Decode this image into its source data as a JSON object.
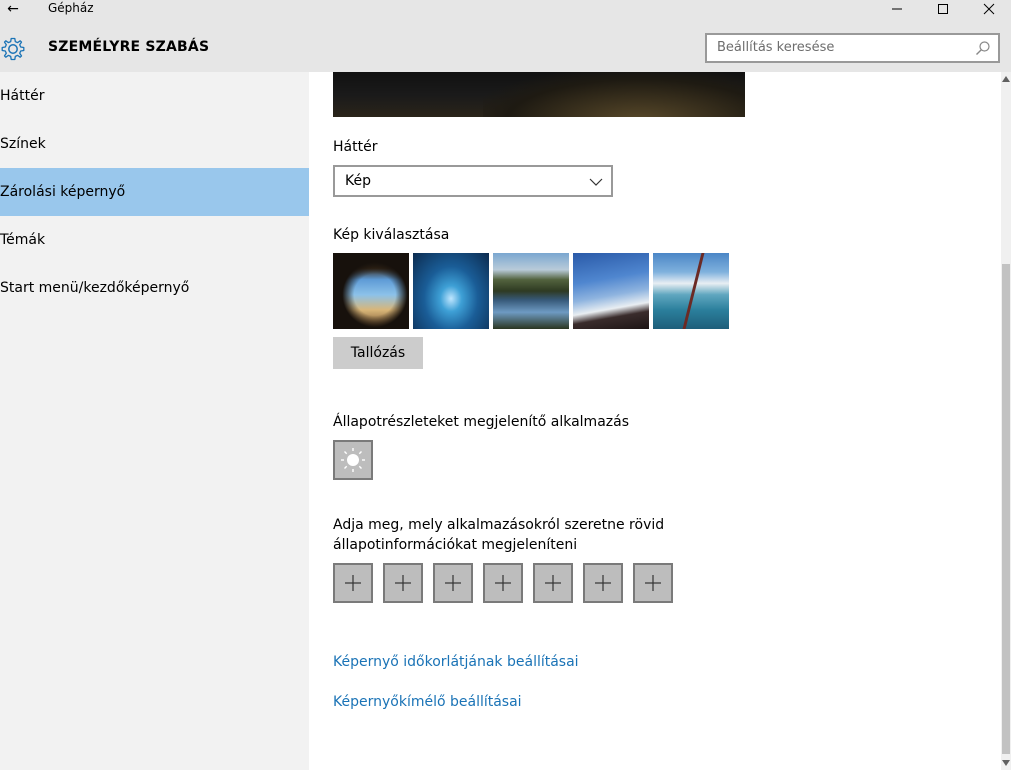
{
  "window": {
    "title": "Gépház",
    "back_glyph": "←"
  },
  "header": {
    "title": "SZEMÉLYRE SZABÁS",
    "search_placeholder": "Beállítás keresése"
  },
  "sidebar": {
    "items": [
      {
        "label": "Háttér",
        "selected": false
      },
      {
        "label": "Színek",
        "selected": false
      },
      {
        "label": "Zárolási képernyő",
        "selected": true
      },
      {
        "label": "Témák",
        "selected": false
      },
      {
        "label": "Start menü/kezdőképernyő",
        "selected": false
      }
    ]
  },
  "content": {
    "background_label": "Háttér",
    "background_select_value": "Kép",
    "choose_picture_label": "Kép kiválasztása",
    "browse_button": "Tallózás",
    "detailed_status_label": "Állapotrészleteket megjelenítő alkalmazás",
    "quick_status_label": "Adja meg, mely alkalmazásokról szeretne rövid állapotinformációkat megjeleníteni",
    "quick_status_slots": 7,
    "links": {
      "screen_timeout": "Képernyő időkorlátjának beállításai",
      "screensaver": "Képernyőkímélő beállításai"
    }
  },
  "colors": {
    "selected_nav": "#99c7ec",
    "accent_link": "#1a73b6",
    "header_bg": "#e6e6e6",
    "sidebar_bg": "#f2f2f2"
  },
  "icons": [
    "back-arrow-icon",
    "minimize-icon",
    "maximize-icon",
    "close-icon",
    "gear-icon",
    "search-icon",
    "chevron-down-icon",
    "weather-sun-icon",
    "plus-icon"
  ]
}
